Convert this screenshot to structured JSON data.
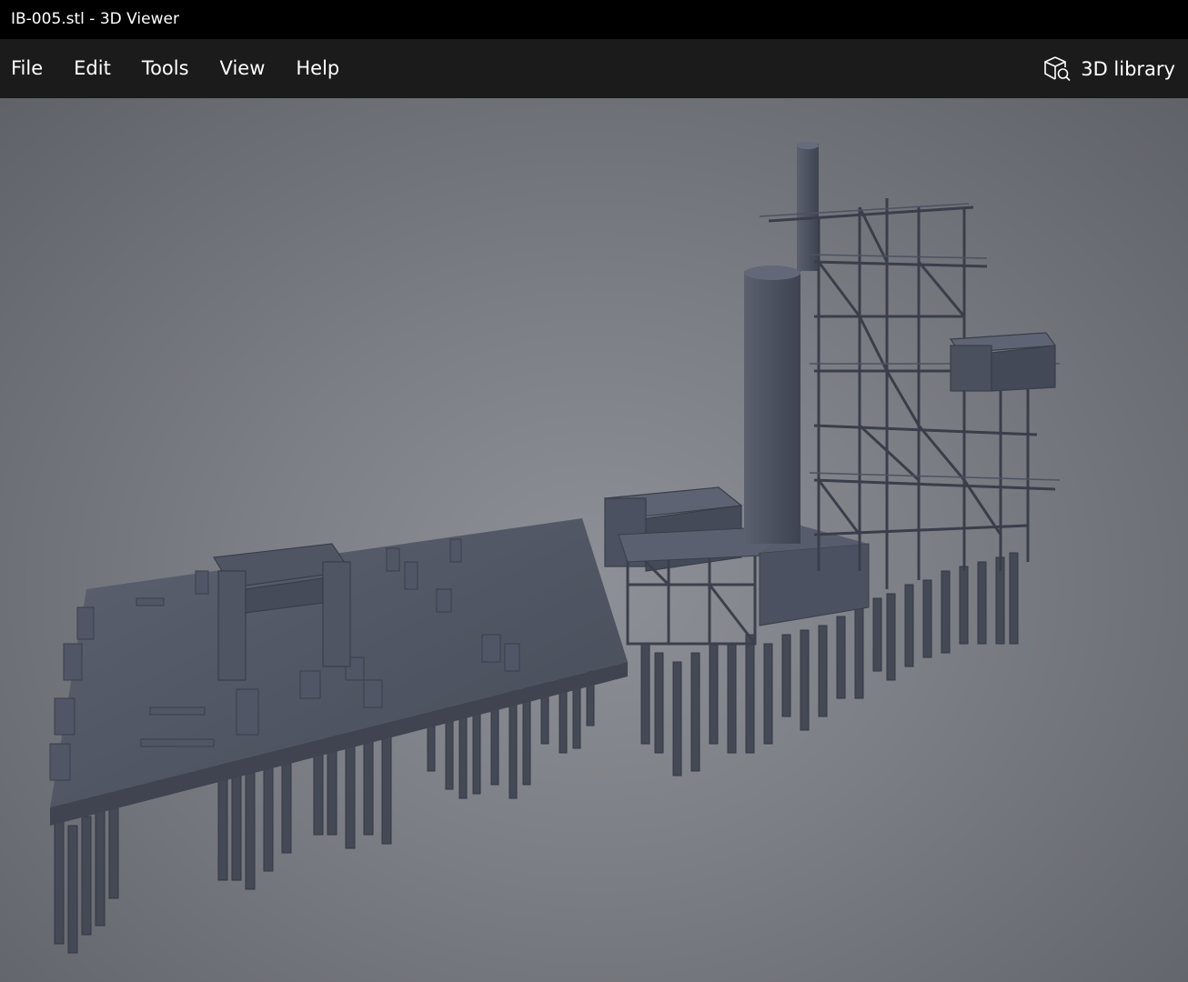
{
  "window": {
    "title": "IB-005.stl - 3D Viewer"
  },
  "menu": {
    "items": [
      {
        "label": "File"
      },
      {
        "label": "Edit"
      },
      {
        "label": "Tools"
      },
      {
        "label": "View"
      },
      {
        "label": "Help"
      }
    ]
  },
  "library_button": {
    "label": "3D library",
    "icon": "cube-search-icon"
  },
  "viewport": {
    "model": "industrial-plant-model"
  },
  "colors": {
    "titlebar": "#000000",
    "menubar": "#1b1b1b",
    "model": "#4e5461",
    "background": "#7c7f85"
  }
}
